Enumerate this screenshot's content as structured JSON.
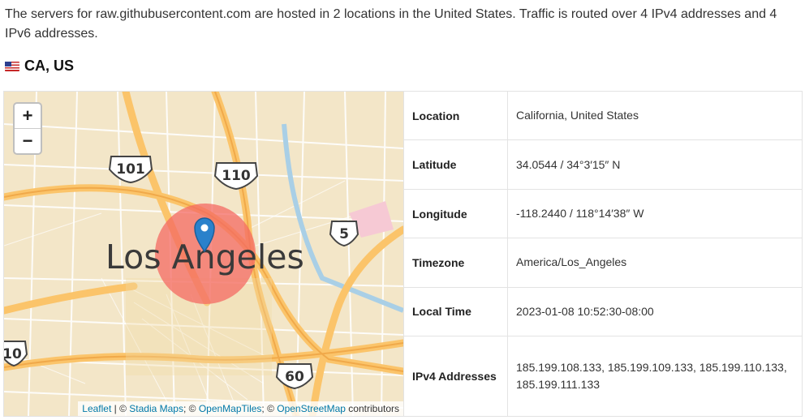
{
  "intro": "The servers for raw.githubusercontent.com are hosted in 2 locations in the United States. Traffic is routed over 4 IPv4 addresses and 4 IPv6 addresses.",
  "location_heading": "CA, US",
  "map": {
    "zoom_in": "+",
    "zoom_out": "−",
    "city_label": "Los Angeles",
    "shields": [
      "101",
      "110",
      "5",
      "10",
      "60"
    ],
    "attribution": {
      "leaflet": "Leaflet",
      "sep1": " | © ",
      "stadia": "Stadia Maps",
      "sep2": "; © ",
      "openmaptiles": "OpenMapTiles",
      "sep3": "; © ",
      "osm": "OpenStreetMap",
      "suffix": " contributors"
    },
    "colors": {
      "background": "#f3e6c8",
      "highway": "#fbc46a",
      "water": "#a9cfe6",
      "circle": "#f46a63"
    }
  },
  "details": [
    {
      "label": "Location",
      "value": "California, United States"
    },
    {
      "label": "Latitude",
      "value": "34.0544 / 34°3′15″ N"
    },
    {
      "label": "Longitude",
      "value": "-118.2440 / 118°14′38″ W"
    },
    {
      "label": "Timezone",
      "value": "America/Los_Angeles"
    },
    {
      "label": "Local Time",
      "value": "2023-01-08 10:52:30-08:00"
    },
    {
      "label": "IPv4 Addresses",
      "value": "185.199.108.133, 185.199.109.133, 185.199.110.133, 185.199.111.133"
    }
  ]
}
